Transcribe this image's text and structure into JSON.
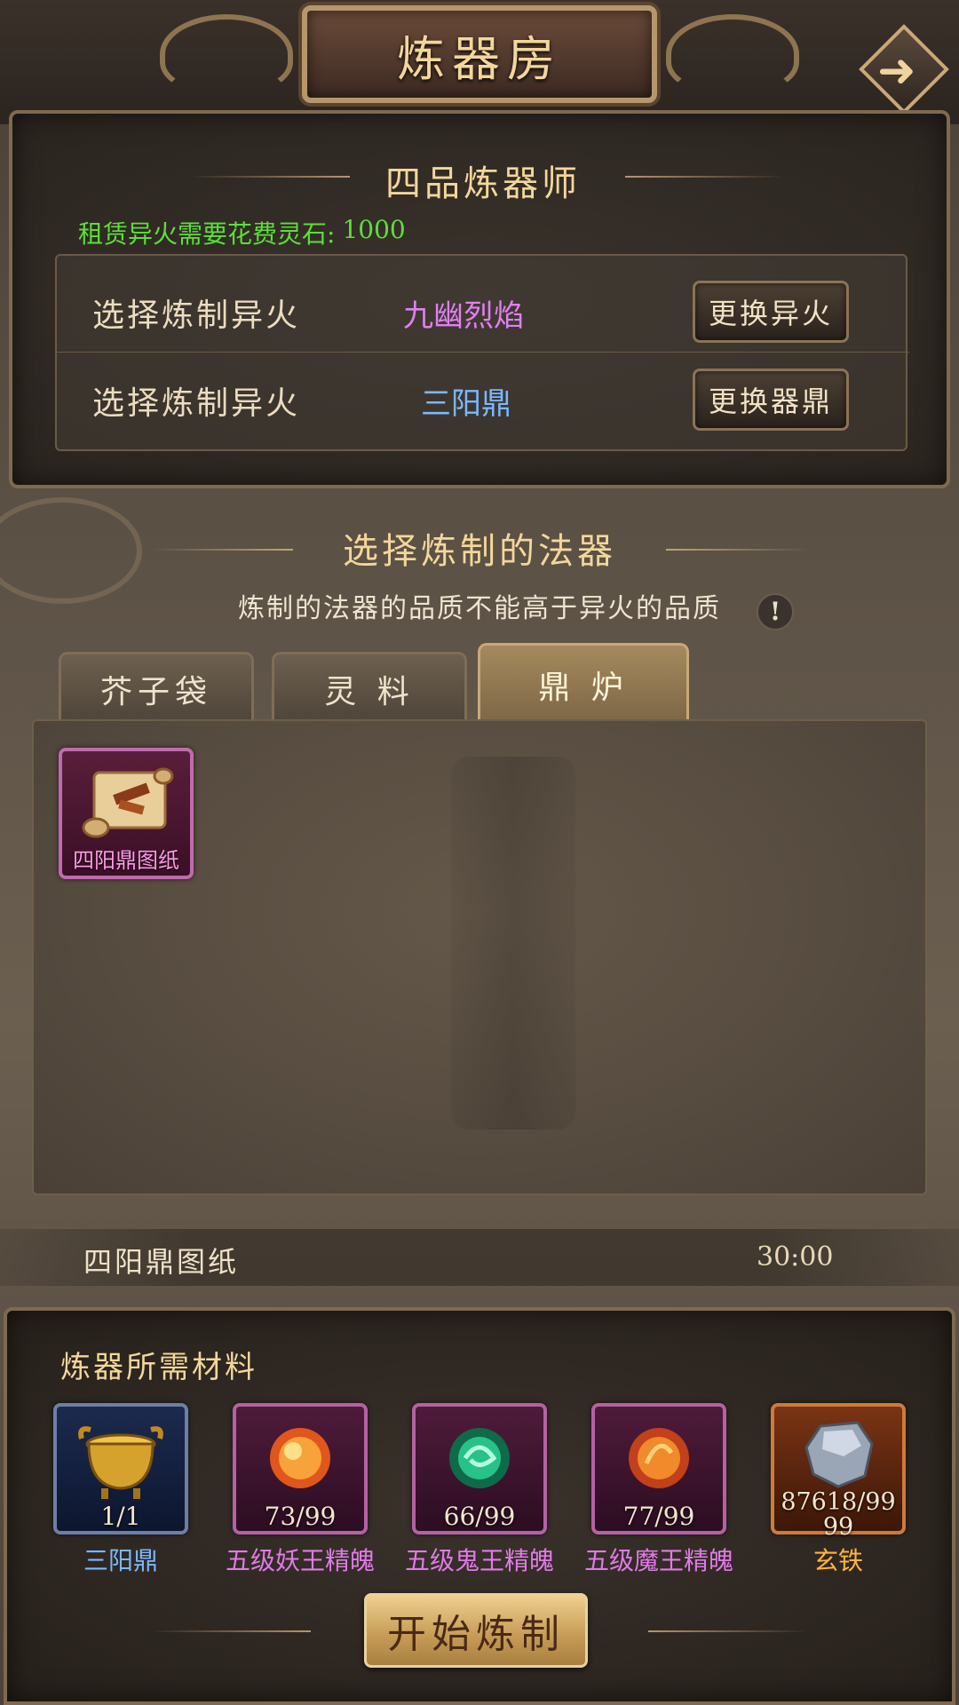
{
  "header": {
    "title": "炼器房",
    "back_icon": "arrow-right-icon"
  },
  "top_panel": {
    "rank_title": "四品炼器师",
    "rent_label": "租赁异火需要花费灵石:",
    "rent_value": "1000",
    "rows": [
      {
        "label": "选择炼制异火",
        "value": "九幽烈焰",
        "button": "更换异火"
      },
      {
        "label": "选择炼制异火",
        "value": "三阳鼎",
        "button": "更换器鼎"
      }
    ]
  },
  "select_section": {
    "title": "选择炼制的法器",
    "note": "炼制的法器的品质不能高于异火的品质",
    "info_glyph": "!",
    "tabs": [
      "芥子袋",
      "灵 料",
      "鼎 炉"
    ],
    "active_tab": 2,
    "items": [
      {
        "name": "四阳鼎图纸",
        "icon": "scroll-blueprint-icon",
        "quality_color": "#c06ab0"
      }
    ]
  },
  "recipe": {
    "name": "四阳鼎图纸",
    "time": "30:00"
  },
  "materials": {
    "title": "炼器所需材料",
    "items": [
      {
        "name": "三阳鼎",
        "count": "1/1",
        "icon": "cauldron-icon",
        "quality": "blue",
        "name_color": "#7ab8ff"
      },
      {
        "name": "五级妖王精魄",
        "count": "73/99",
        "icon": "fire-orb-icon",
        "quality": "purple",
        "name_color": "#e07ae8"
      },
      {
        "name": "五级鬼王精魄",
        "count": "66/99",
        "icon": "jade-orb-icon",
        "quality": "purple",
        "name_color": "#e07ae8"
      },
      {
        "name": "五级魔王精魄",
        "count": "77/99",
        "icon": "flame-orb-icon",
        "quality": "purple",
        "name_color": "#e07ae8"
      },
      {
        "name": "玄铁",
        "count": "87618/9999",
        "icon": "iron-ore-icon",
        "quality": "orange",
        "name_color": "#ffb53a"
      }
    ],
    "start_button": "开始炼制"
  },
  "colors": {
    "gold_text": "#f3d79a",
    "rent_green": "#5be038",
    "purple_value": "#e080f0",
    "blue_value": "#7ab8ff"
  }
}
